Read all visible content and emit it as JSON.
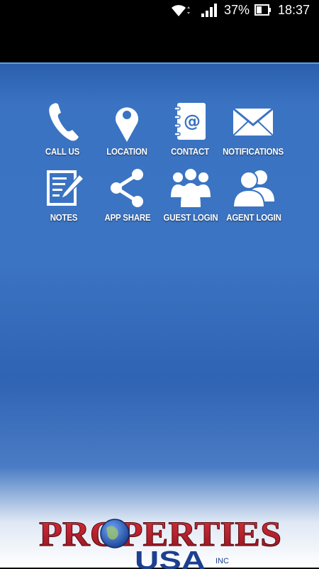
{
  "status_bar": {
    "battery_percent": "37%",
    "time": "18:37",
    "icons": [
      "wifi-icon",
      "signal-icon",
      "battery-icon"
    ]
  },
  "tiles": [
    {
      "label": "CALL US",
      "icon": "phone-icon"
    },
    {
      "label": "LOCATION",
      "icon": "map-pin-icon"
    },
    {
      "label": "CONTACT",
      "icon": "address-book-icon"
    },
    {
      "label": "NOTIFICATIONS",
      "icon": "envelope-icon"
    },
    {
      "label": "NOTES",
      "icon": "notepad-icon"
    },
    {
      "label": "APP SHARE",
      "icon": "share-icon"
    },
    {
      "label": "GUEST LOGIN",
      "icon": "group-icon"
    },
    {
      "label": "AGENT LOGIN",
      "icon": "users-icon"
    }
  ],
  "logo": {
    "line1": "PROPERTIES",
    "line2": "USA",
    "suffix": "INC",
    "colors": {
      "red": "#c21f2d",
      "blue": "#1d3f8f"
    }
  },
  "colors": {
    "background_blue": "#3a73c2",
    "status_bar": "#000000",
    "accent_line": "#5aa0e6"
  }
}
